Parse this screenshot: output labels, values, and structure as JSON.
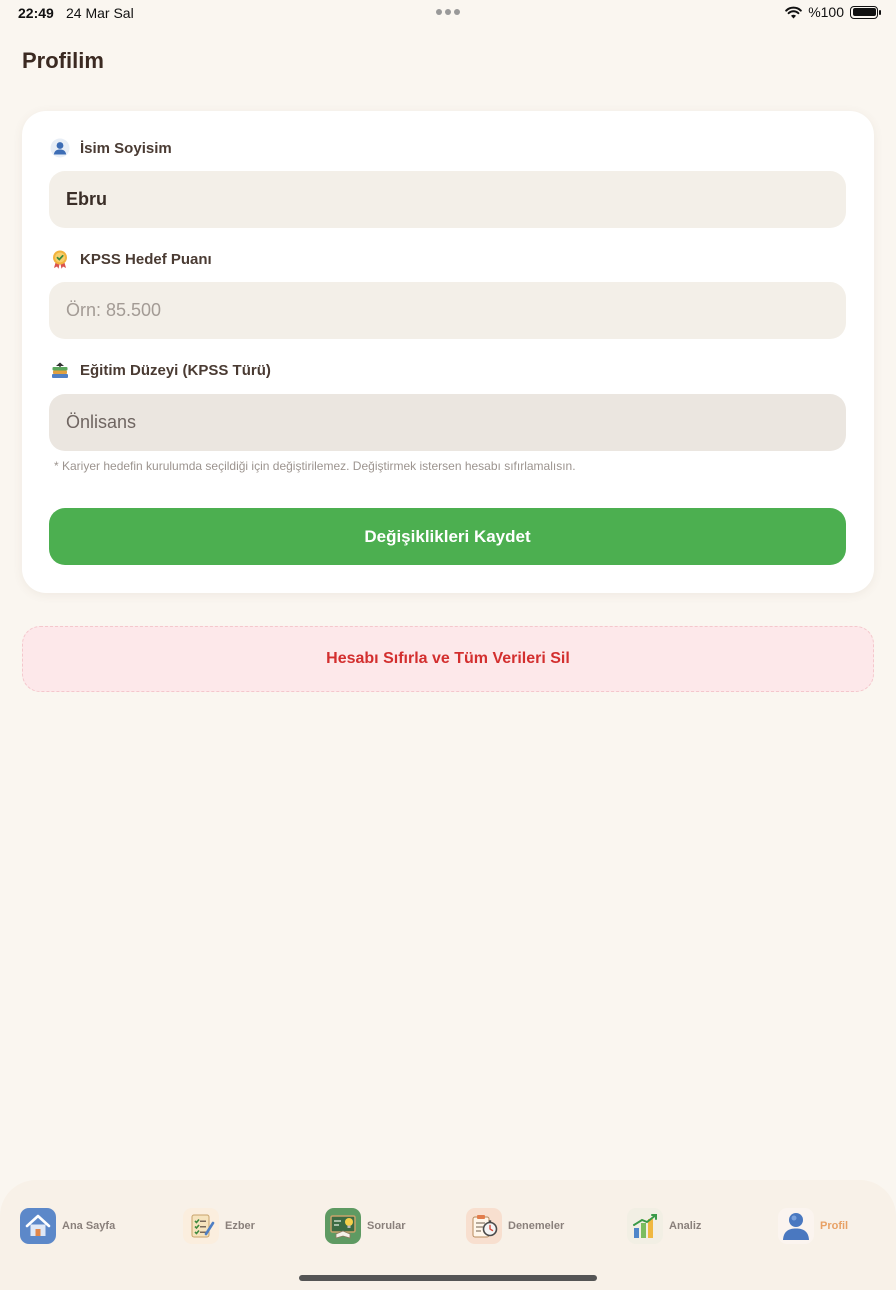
{
  "status": {
    "time": "22:49",
    "date": "24 Mar Sal",
    "battery": "%100"
  },
  "page": {
    "title": "Profilim"
  },
  "form": {
    "name": {
      "label": "İsim Soyisim",
      "icon": "user-icon",
      "value": "Ebru"
    },
    "target_score": {
      "label": "KPSS Hedef Puanı",
      "icon": "medal-icon",
      "placeholder": "Örn: 85.500"
    },
    "education": {
      "label": "Eğitim Düzeyi (KPSS Türü)",
      "icon": "books-icon",
      "value": "Önlisans",
      "helper": "* Kariyer hedefin kurulumda seçildiği için değiştirilemez. Değiştirmek istersen hesabı sıfırlamalısın."
    },
    "save_label": "Değişiklikleri Kaydet"
  },
  "reset_label": "Hesabı Sıfırla ve Tüm Verileri Sil",
  "colors": {
    "accent_green": "#4caf50",
    "danger_red": "#d32f2f",
    "active_tab": "#e8a165"
  },
  "tabs": [
    {
      "label": "Ana Sayfa",
      "icon": "house-icon",
      "active": false
    },
    {
      "label": "Ezber",
      "icon": "checklist-icon",
      "active": false
    },
    {
      "label": "Sorular",
      "icon": "chalkboard-icon",
      "active": false
    },
    {
      "label": "Denemeler",
      "icon": "stopwatch-clipboard-icon",
      "active": false
    },
    {
      "label": "Analiz",
      "icon": "bar-chart-icon",
      "active": false
    },
    {
      "label": "Profil",
      "icon": "profile-icon",
      "active": true
    }
  ]
}
